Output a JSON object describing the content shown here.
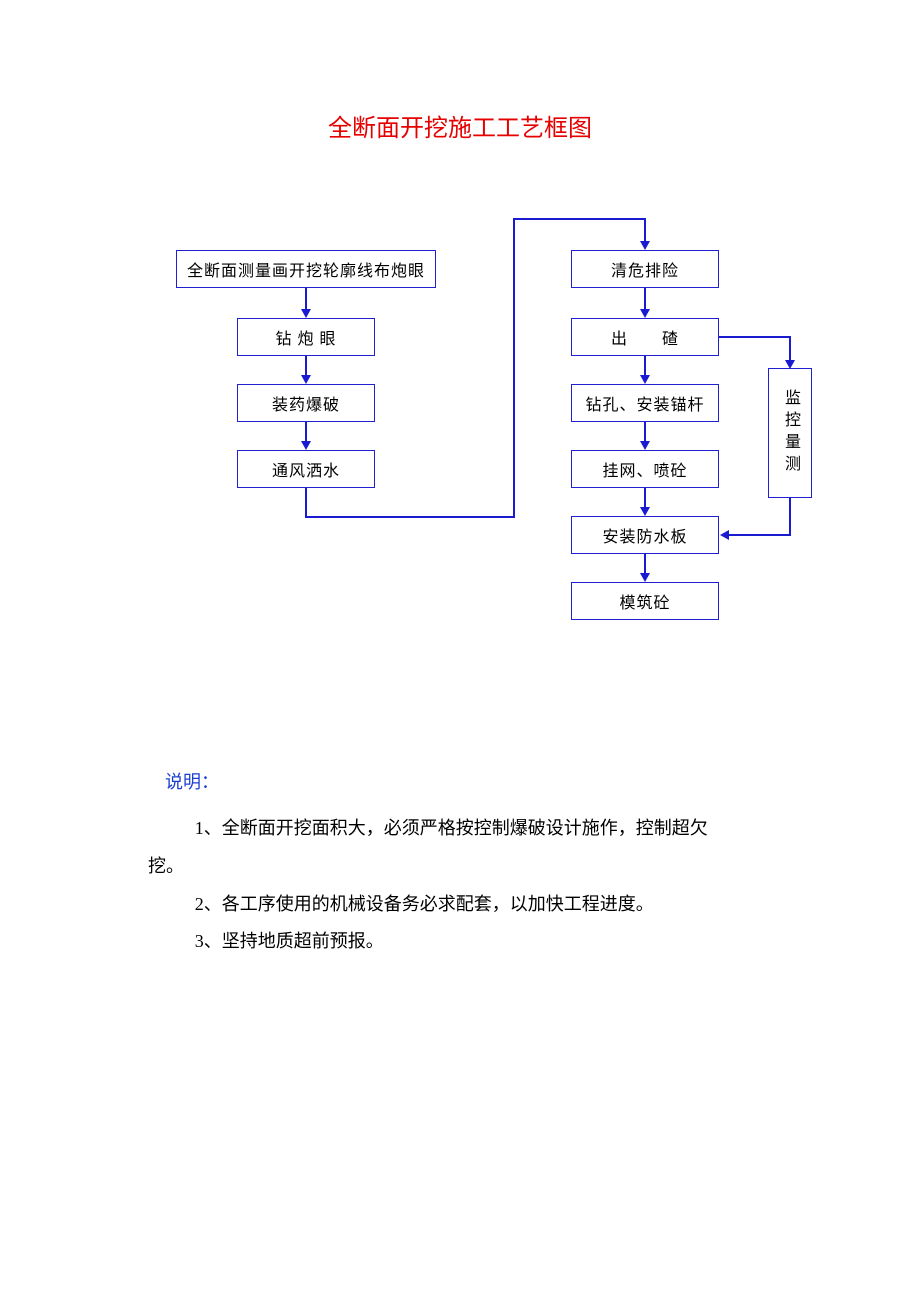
{
  "title": "全断面开挖施工工艺框图",
  "flow": {
    "left1": "全断面测量画开挖轮廓线布炮眼",
    "left2": "钻 炮 眼",
    "left3": "装药爆破",
    "left4": "通风洒水",
    "right1": "清危排险",
    "right2": "出　　碴",
    "right3": "钻孔、安装锚杆",
    "right4": "挂网、喷砼",
    "right5": "安装防水板",
    "right6": "模筑砼",
    "side": "监控量测"
  },
  "notes": {
    "heading": "说明：",
    "item1a": "1、全断面开挖面积大，必须严格按控制爆破设计施作，控制超欠",
    "item1b": "挖。",
    "item2": "2、各工序使用的机械设备务必求配套，以加快工程进度。",
    "item3": "3、坚持地质超前预报。"
  },
  "colors": {
    "title": "#e60000",
    "stroke": "#1a1ad0",
    "notes_heading": "#1a3fcf"
  }
}
